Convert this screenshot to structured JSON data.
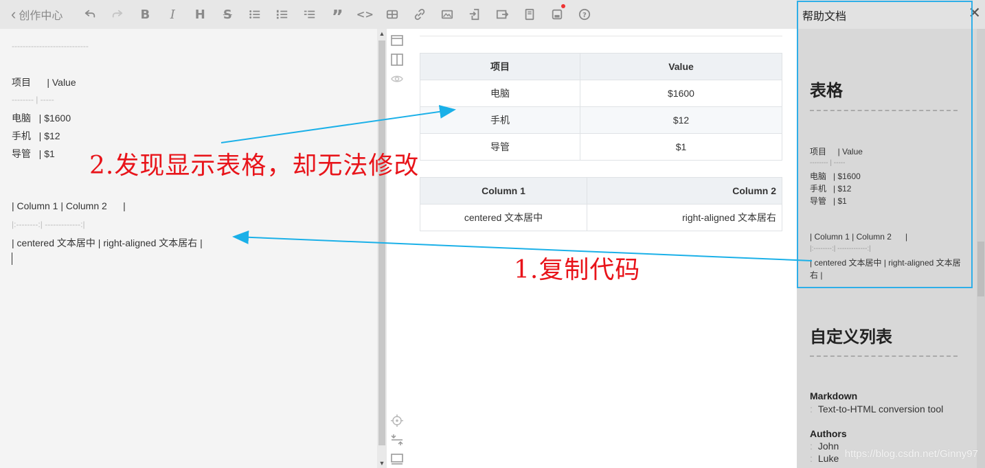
{
  "toolbar": {
    "back_label": "创作中心",
    "icons": [
      "undo-icon",
      "redo-icon",
      "bold-icon",
      "italic-icon",
      "heading-icon",
      "strikethrough-icon",
      "unordered-list-icon",
      "ordered-list-icon",
      "task-list-icon",
      "quote-icon",
      "code-icon",
      "table-icon",
      "link-icon",
      "image-icon",
      "import-icon",
      "export-icon",
      "template-icon",
      "save-icon",
      "help-icon"
    ],
    "bold_glyph": "B",
    "italic_glyph": "I",
    "heading_glyph": "H",
    "strike_glyph": "S",
    "quote_glyph": "”",
    "code_glyph": "<>"
  },
  "editor": {
    "dashes": "----------------------------",
    "table1_header": "项目      | Value",
    "table1_sep": "-------- | -----",
    "table1_rows": [
      "电脑   | $1600",
      "手机   | $12",
      "导管   | $1"
    ],
    "table2_header": "| Column 1 | Column 2      |",
    "table2_sep": "|:--------:| -------------:|",
    "table2_row": "| centered 文本居中 | right-aligned 文本居右 |"
  },
  "preview": {
    "table1": {
      "headers": [
        "项目",
        "Value"
      ],
      "rows": [
        [
          "电脑",
          "$1600"
        ],
        [
          "手机",
          "$12"
        ],
        [
          "导管",
          "$1"
        ]
      ]
    },
    "table2": {
      "headers": [
        "Column 1",
        "Column 2"
      ],
      "rows": [
        [
          "centered 文本居中",
          "right-aligned 文本居右"
        ]
      ]
    }
  },
  "help": {
    "title": "帮助文档",
    "section1_title": "表格",
    "s1_header": "项目     | Value",
    "s1_sep": "-------- | -----",
    "s1_rows": [
      "电脑   | $1600",
      "手机   | $12",
      "导管   | $1"
    ],
    "s1_t2_header": "| Column 1 | Column 2      |",
    "s1_t2_sep": "|:--------:| -------------:|",
    "s1_t2_row_a": "| centered 文本居中 | right-aligned 文本居",
    "s1_t2_row_b": "右 |",
    "section2_title": "自定义列表",
    "def_terms": [
      {
        "term": "Markdown",
        "defs": [
          "Text-to-HTML conversion tool"
        ]
      },
      {
        "term": "Authors",
        "defs": [
          "John",
          "Luke"
        ]
      }
    ]
  },
  "annotations": {
    "step1": "1.复制代码",
    "step2": "2.发现显示表格，却无法修改",
    "color": "#e8141a",
    "arrow_color": "#1ab0e8"
  },
  "watermark": "https://blog.csdn.net/Ginny97"
}
